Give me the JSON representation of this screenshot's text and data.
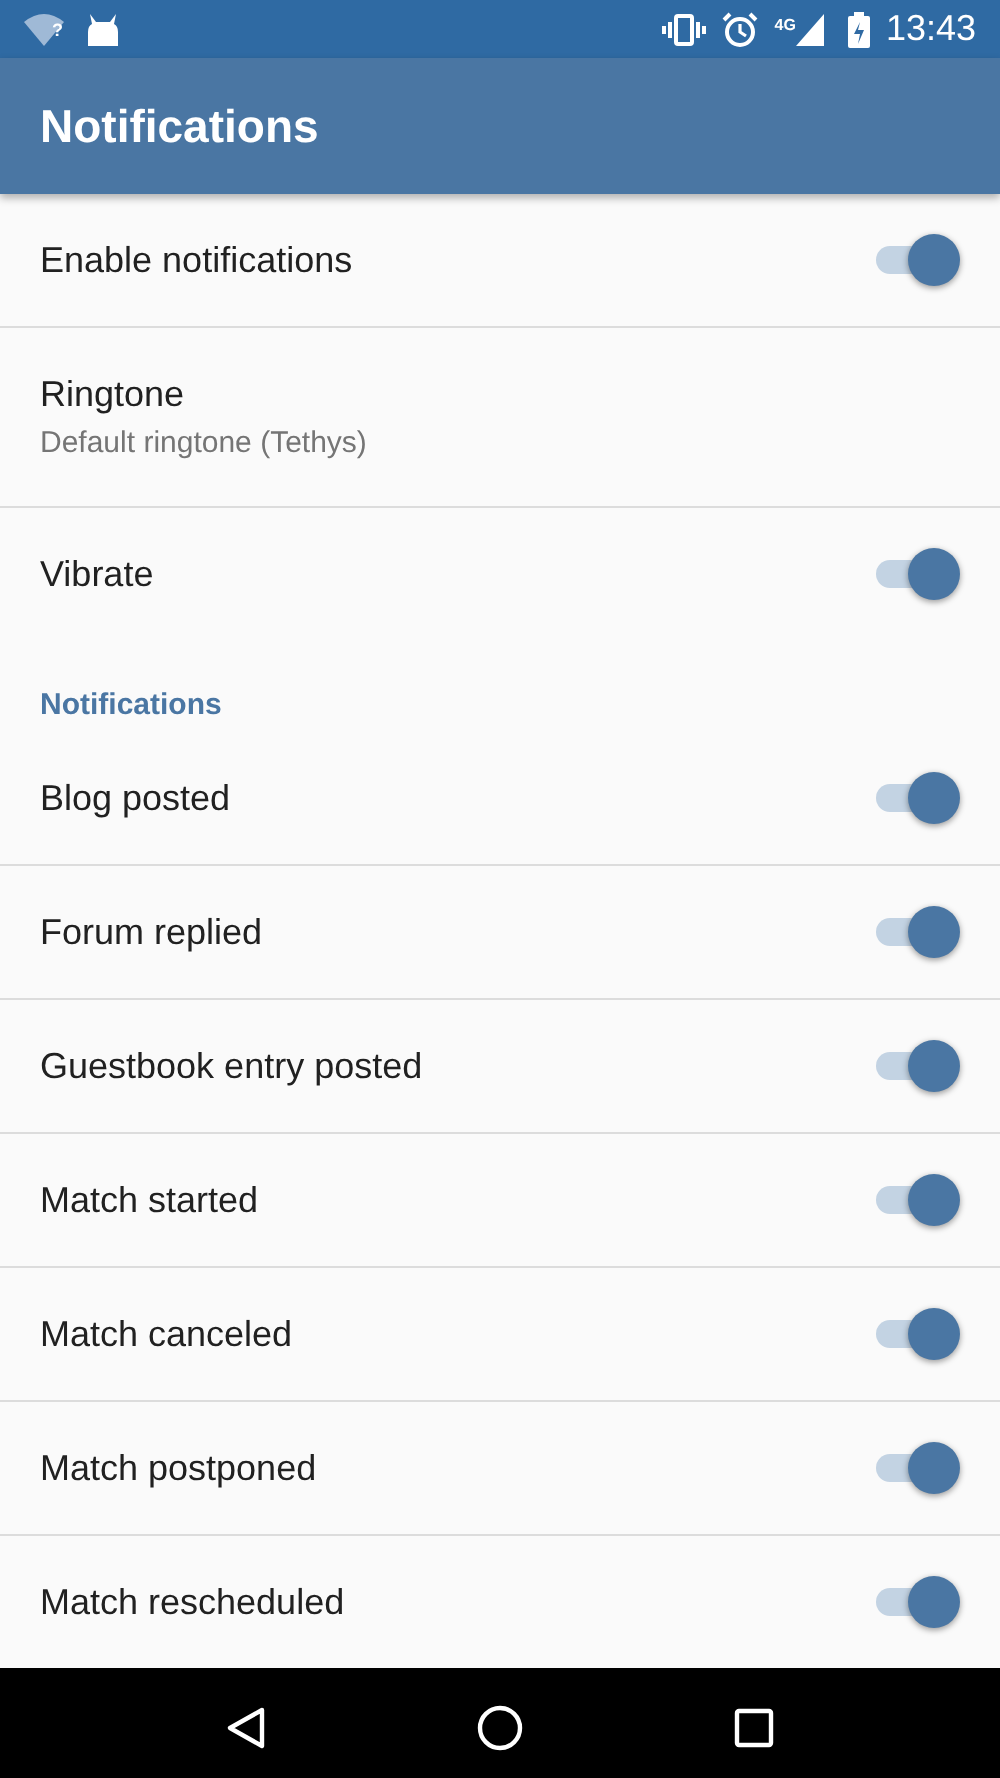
{
  "status_bar": {
    "wifi_label": "?",
    "network_label": "4G",
    "time": "13:43"
  },
  "app_bar": {
    "title": "Notifications"
  },
  "sections": [
    {
      "items": [
        {
          "kind": "switch",
          "title": "Enable notifications",
          "on": true
        },
        {
          "kind": "preference",
          "title": "Ringtone",
          "summary": "Default ringtone (Tethys)"
        },
        {
          "kind": "switch",
          "title": "Vibrate",
          "on": true
        }
      ]
    },
    {
      "title": "Notifications",
      "items": [
        {
          "kind": "switch",
          "title": "Blog posted",
          "on": true
        },
        {
          "kind": "switch",
          "title": "Forum replied",
          "on": true
        },
        {
          "kind": "switch",
          "title": "Guestbook entry posted",
          "on": true
        },
        {
          "kind": "switch",
          "title": "Match started",
          "on": true
        },
        {
          "kind": "switch",
          "title": "Match canceled",
          "on": true
        },
        {
          "kind": "switch",
          "title": "Match postponed",
          "on": true
        },
        {
          "kind": "switch",
          "title": "Match rescheduled",
          "on": true
        }
      ]
    }
  ]
}
